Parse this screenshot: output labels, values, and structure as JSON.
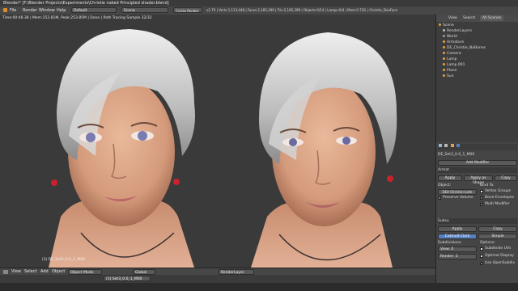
{
  "titlebar": {
    "title": "Blender* [F:\\Blender Projects\\Experiments\\Christie naked Principled shader.blend]"
  },
  "menubar": {
    "file": "File",
    "render": "Render",
    "window": "Window",
    "help": "Help",
    "layout": "Default",
    "scene": "Scene",
    "engine": "Cycles Render",
    "stats": "v2.79 | Verts:1,113,448 | Faces:2,185,399 | Tris:2,185,399 | Objects:0/14 | Lamps:0/4 | Mem:0.73G | Christie_SkinFace"
  },
  "viewport": {
    "render_info": "Time:00:48.38 | Mem:253.81M, Peak:253.85M | Done | Path Tracing Sample 32/32",
    "object_label": "(1) DE_Set3_0.0_1_M00"
  },
  "bottom_bar": {
    "view": "View",
    "select": "Select",
    "add": "Add",
    "object": "Object",
    "mode": "Object Mode",
    "pivot": "Global",
    "layer_field": "(1) Set3_0.0_1_M00",
    "layer": "RenderLayer"
  },
  "outliner": {
    "tab_view": "View",
    "tab_search": "Search",
    "tab_scenes": "All Scenes",
    "items": [
      {
        "label": "Scene"
      },
      {
        "label": "RenderLayers"
      },
      {
        "label": "World"
      },
      {
        "label": "Armature"
      },
      {
        "label": "DE_Christie_NoBones"
      },
      {
        "label": "Camera"
      },
      {
        "label": "Lamp"
      },
      {
        "label": "Lamp.001"
      },
      {
        "label": "Plane"
      },
      {
        "label": "Sun"
      }
    ]
  },
  "properties": {
    "object_name": "DE_Set3_0.0_1_M00",
    "add_modifier": "Add Modifier",
    "mod1_name": "Armat",
    "apply": "Apply",
    "apply_shape": "Apply as Shape",
    "copy": "Copy",
    "object_label": "Object:",
    "bind_label": "Bind To:",
    "object_value": "DE4-Christie+Late",
    "vertex_groups": "Vertex Groups",
    "preserve_volume": "Preserve Volume",
    "bone_envelopes": "Bone Envelopes",
    "multi_modifier": "Multi Modifier",
    "mod2_name": "Subsu",
    "apply2": "Apply",
    "copy2": "Copy",
    "catmull": "Catmull-Clark",
    "simple": "Simple",
    "subdivisions": "Subdivisions:",
    "options": "Options:",
    "view_field": "View:",
    "view_value": "0",
    "render_field": "Render:",
    "render_value": "2",
    "subdivide_uvs": "Subdivide UVs",
    "optimal_display": "Optimal Display",
    "use_opensubdiv": "Use OpenSubdiv"
  },
  "colors": {
    "accent": "#5680c2",
    "panel": "#454545",
    "viewport": "#3c3c3c"
  }
}
